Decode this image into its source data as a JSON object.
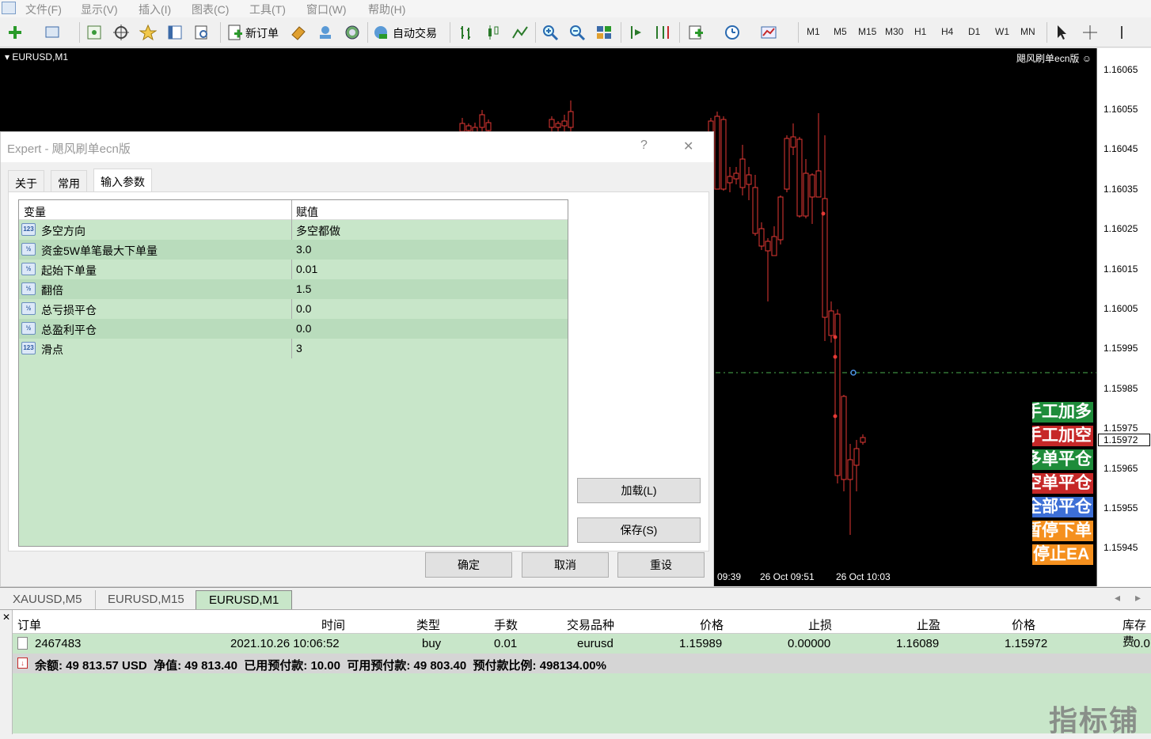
{
  "menu": [
    "文件(F)",
    "显示(V)",
    "插入(I)",
    "图表(C)",
    "工具(T)",
    "窗口(W)",
    "帮助(H)"
  ],
  "toolbar": {
    "new_order": "新订单",
    "auto_trade": "自动交易",
    "timeframes": [
      "M1",
      "M5",
      "M15",
      "M30",
      "H1",
      "H4",
      "D1",
      "W1",
      "MN"
    ]
  },
  "chart": {
    "title": "EURUSD,M1",
    "ea_name": "飓风刷单ecn版",
    "current_price": "1.15972",
    "price_ticks": [
      "1.16065",
      "1.16055",
      "1.16045",
      "1.16035",
      "1.16025",
      "1.16015",
      "1.16005",
      "1.15995",
      "1.15985",
      "1.15975",
      "1.15965",
      "1.15955",
      "1.15945"
    ],
    "time_labels": [
      "09:39",
      "26 Oct 09:51",
      "26 Oct 10:03"
    ],
    "buttons": [
      {
        "label": "手工加多",
        "color": "#1e8c3a"
      },
      {
        "label": "手工加空",
        "color": "#c62828"
      },
      {
        "label": "多单平仓",
        "color": "#1e8c3a"
      },
      {
        "label": "空单平仓",
        "color": "#c62828"
      },
      {
        "label": "全部平仓",
        "color": "#3d6fd6"
      },
      {
        "label": "暂停下单",
        "color": "#f5901e"
      },
      {
        "label": "停止EA",
        "color": "#f5901e"
      }
    ]
  },
  "dialog": {
    "title": "Expert - 飓风刷单ecn版",
    "help_icon": "?",
    "close_icon": "✕",
    "tabs": [
      "关于",
      "常用",
      "输入参数"
    ],
    "table": {
      "col_var": "变量",
      "col_val": "赋值",
      "rows": [
        {
          "type": "123",
          "name": "多空方向",
          "value": "多空都做"
        },
        {
          "type": "½",
          "name": "资金5W单笔最大下单量",
          "value": "3.0"
        },
        {
          "type": "½",
          "name": "起始下单量",
          "value": "0.01"
        },
        {
          "type": "½",
          "name": "翻倍",
          "value": "1.5"
        },
        {
          "type": "½",
          "name": "总亏损平仓",
          "value": "0.0"
        },
        {
          "type": "½",
          "name": "总盈利平仓",
          "value": "0.0"
        },
        {
          "type": "123",
          "name": "滑点",
          "value": "3"
        }
      ]
    },
    "load_btn": "加载(L)",
    "save_btn": "保存(S)",
    "ok_btn": "确定",
    "cancel_btn": "取消",
    "reset_btn": "重设"
  },
  "chart_tabs": [
    "XAUUSD,M5",
    "EURUSD,M15",
    "EURUSD,M1"
  ],
  "terminal": {
    "columns": [
      "订单",
      "时间",
      "类型",
      "手数",
      "交易品种",
      "价格",
      "止损",
      "止盈",
      "价格",
      "库存费"
    ],
    "order": {
      "id": "2467483",
      "time": "2021.10.26 10:06:52",
      "type": "buy",
      "lots": "0.01",
      "symbol": "eurusd",
      "price": "1.15989",
      "sl": "0.00000",
      "tp": "1.16089",
      "current": "1.15972",
      "swap": "0.0"
    },
    "balance": "余额: 49 813.57 USD  净值: 49 813.40  已用预付款: 10.00  可用预付款: 49 803.40  预付款比例: 498134.00%"
  },
  "watermark": "指标铺"
}
